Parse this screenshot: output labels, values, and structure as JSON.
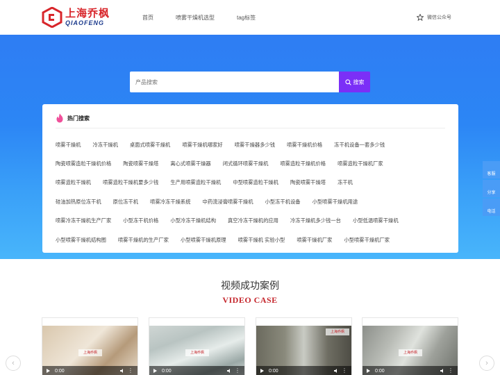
{
  "header": {
    "logo_cn": "上海乔枫",
    "logo_en": "QIAOFENG",
    "nav": [
      "首页",
      "喷雾干燥机选型",
      "tag标签"
    ],
    "wechat": "微信公众号"
  },
  "search": {
    "placeholder": "产品搜索",
    "button_label": "搜索"
  },
  "hot": {
    "title": "热门搜索",
    "rows": [
      [
        "喷雾干燥机",
        "冷冻干燥机",
        "桌面式喷雾干燥机",
        "喷雾干燥机哪家好",
        "喷雾干燥器多少钱",
        "喷雾干燥机价格",
        "冻干机设备一套多少钱"
      ],
      [
        "陶瓷喷雾造粒干燥机价格",
        "陶瓷喷雾干燥塔",
        "离心式喷雾干燥器",
        "闭式循环喷雾干燥机",
        "喷雾造粒干燥机价格",
        "喷雾造粒干燥机厂家"
      ],
      [
        "喷雾造粒干燥机",
        "喷雾造粒干燥机要多少钱",
        "生产用喷雾造粒干燥机",
        "中型喷雾造粒干燥机",
        "陶瓷喷雾干燥塔",
        "冻干机"
      ],
      [
        "硅油加热原位冻干机",
        "原位冻干机",
        "喷雾冷冻干燥系统",
        "中药流浸膏喷雾干燥机",
        "小型冻干机设备",
        "小型喷雾干燥机用途"
      ],
      [
        "喷雾冷冻干燥机生产厂家",
        "小型冻干机价格",
        "小型冷冻干燥机结构",
        "真空冷冻干燥机的应用",
        "冷冻干燥机多少钱一台",
        "小型低温喷雾干燥机"
      ],
      [
        "小型喷雾干燥机结构图",
        "喷雾干燥机的生产厂家",
        "小型喷雾干燥机原理",
        "喷雾干燥机 实验小型",
        "喷雾干燥机厂家",
        "小型喷雾干燥机厂家"
      ]
    ]
  },
  "side": [
    "客服",
    "分享",
    "电话"
  ],
  "videos": {
    "title": "视频成功案例",
    "subtitle": "VIDEO CASE",
    "items": [
      {
        "time": "0:00",
        "watermark": "上海乔枫"
      },
      {
        "time": "0:00",
        "watermark": "上海乔枫"
      },
      {
        "time": "0:00",
        "watermark": "上海乔枫"
      },
      {
        "time": "0:00",
        "watermark": "上海乔枫"
      }
    ]
  },
  "colors": {
    "accent": "#7b2ff7",
    "hero_top": "#2e7df3",
    "hero_bottom": "#48b5fb",
    "brand_red": "#c5262c"
  }
}
